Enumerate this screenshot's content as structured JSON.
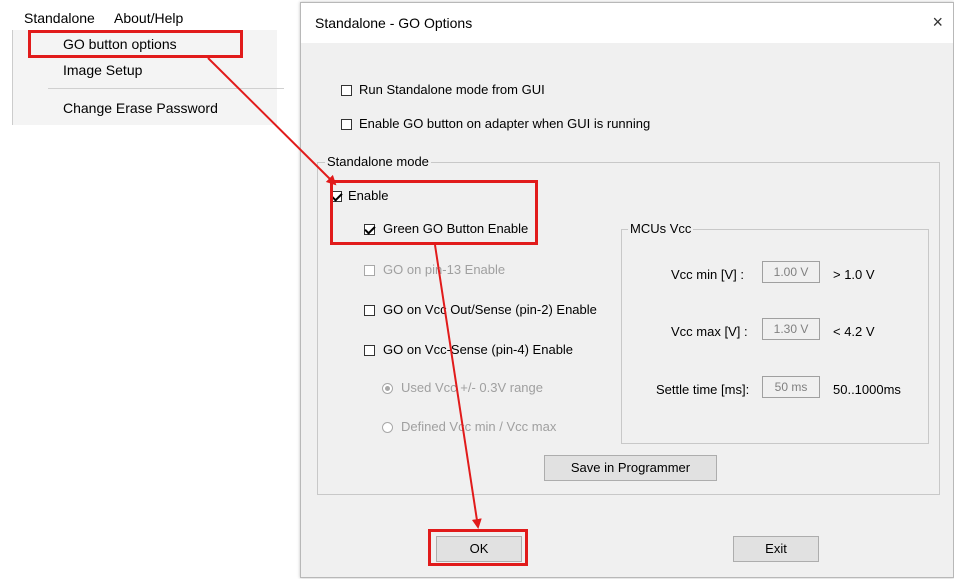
{
  "menubar": {
    "standalone": "Standalone",
    "about": "About/Help"
  },
  "menu": {
    "go_button_options": "GO button options",
    "image_setup": "Image Setup",
    "change_erase_password": "Change Erase Password"
  },
  "dialog": {
    "title": "Standalone  - GO Options",
    "close": "×",
    "run_standalone": "Run Standalone mode from GUI",
    "enable_go_adapter": "Enable GO button on adapter when GUI is running",
    "standalone_group": "Standalone mode",
    "enable": "Enable",
    "green_go": "Green GO Button Enable",
    "go_pin13": "GO on pin-13 Enable",
    "go_vcc_out": "GO on Vcc Out/Sense (pin-2) Enable",
    "go_vcc_sense": "GO on Vcc-Sense (pin-4) Enable",
    "radio_used": "Used Vcc +/- 0.3V range",
    "radio_defined": "Defined Vcc min / Vcc max",
    "mcus_group": "MCUs Vcc",
    "vcc_min_label": "Vcc min [V] :",
    "vcc_min_value": "1.00 V",
    "vcc_min_limit": "> 1.0 V",
    "vcc_max_label": "Vcc max [V] :",
    "vcc_max_value": "1.30 V",
    "vcc_max_limit": "< 4.2 V",
    "settle_label": "Settle time [ms]:",
    "settle_value": "50 ms",
    "settle_range": "50..1000ms",
    "save_button": "Save in Programmer",
    "ok_button": "OK",
    "exit_button": "Exit"
  },
  "annotation_color": "#e11b1b"
}
